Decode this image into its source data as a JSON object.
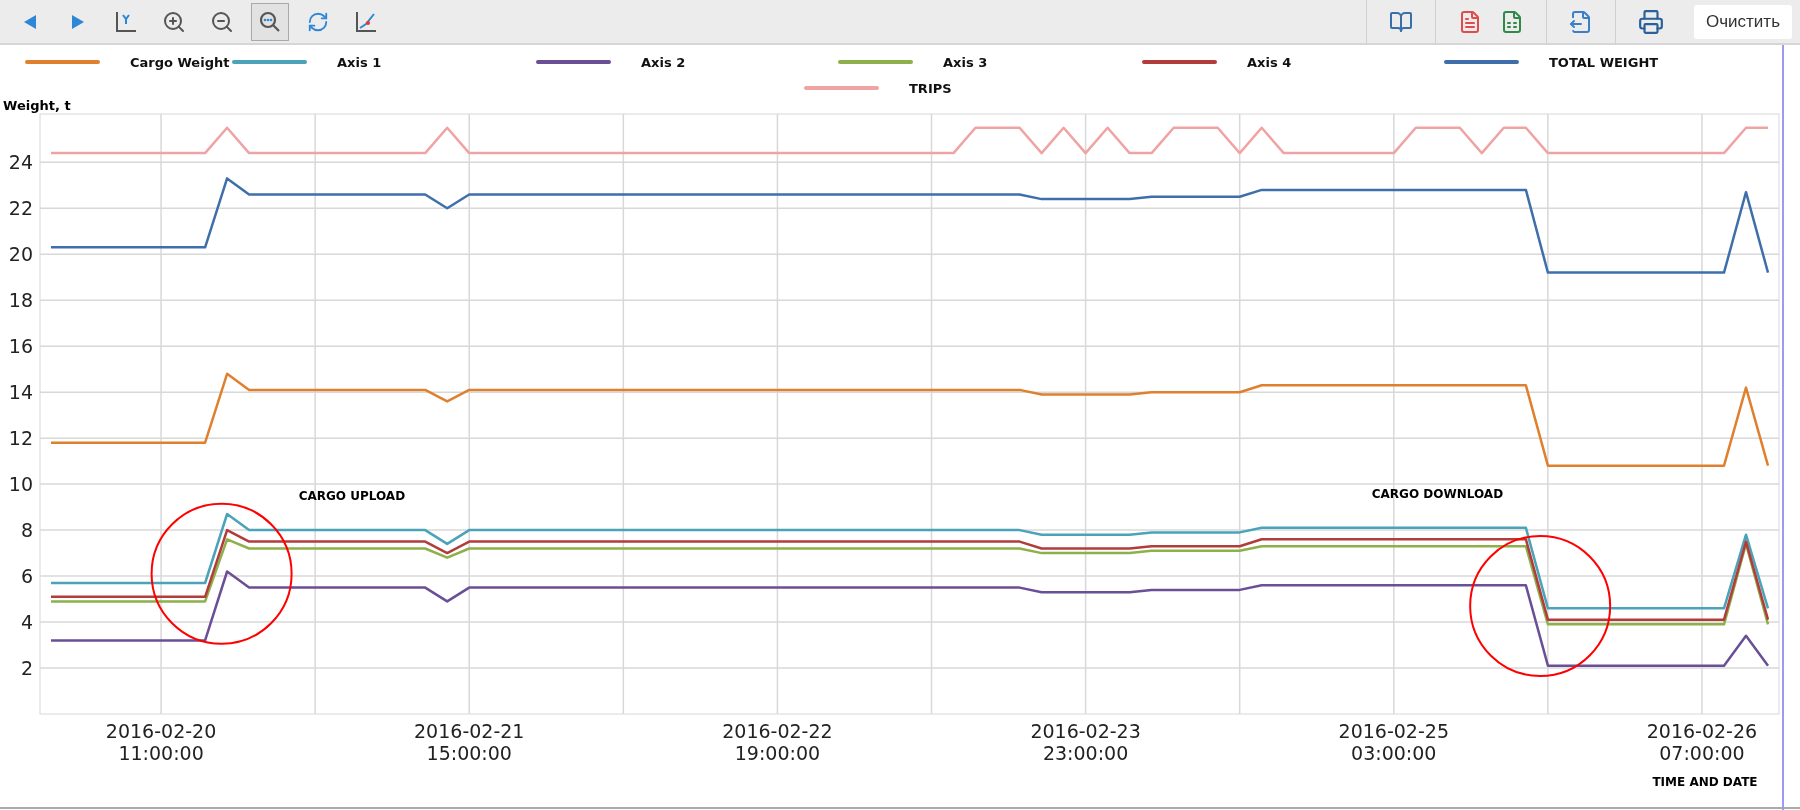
{
  "toolbar": {
    "tools": [
      {
        "kind": "prev",
        "selected": false
      },
      {
        "kind": "next",
        "selected": false
      },
      {
        "kind": "y-axis",
        "selected": false
      },
      {
        "kind": "zoom-in",
        "selected": false
      },
      {
        "kind": "zoom-out",
        "selected": false
      },
      {
        "kind": "zoom-fit",
        "selected": true
      },
      {
        "kind": "refresh",
        "selected": false
      },
      {
        "kind": "chart",
        "selected": false
      }
    ],
    "right_groups": [
      [
        {
          "kind": "book"
        }
      ],
      [
        {
          "kind": "pdf"
        },
        {
          "kind": "excel"
        }
      ],
      [
        {
          "kind": "export"
        }
      ],
      [
        {
          "kind": "print"
        }
      ]
    ],
    "clear_button": {
      "label": "Очистить"
    }
  },
  "chart_data": {
    "type": "line",
    "xlabel": "TIME AND DATE",
    "ylabel": "Weight, t",
    "categories": [
      null,
      null,
      null,
      null,
      null,
      "2016-02-20\n11:00:00",
      null,
      null,
      null,
      null,
      null,
      null,
      null,
      null,
      null,
      null,
      null,
      null,
      null,
      "2016-02-21\n15:00:00",
      null,
      null,
      null,
      null,
      null,
      null,
      null,
      null,
      null,
      null,
      null,
      null,
      null,
      "2016-02-22\n19:00:00",
      null,
      null,
      null,
      null,
      null,
      null,
      null,
      null,
      null,
      null,
      null,
      null,
      null,
      "2016-02-23\n23:00:00",
      null,
      null,
      null,
      null,
      null,
      null,
      null,
      null,
      null,
      null,
      null,
      null,
      null,
      "2016-02-25\n03:00:00",
      null,
      null,
      null,
      null,
      null,
      null,
      null,
      null,
      null,
      null,
      null,
      null,
      null,
      "2016-02-26\n07:00:00",
      null,
      null,
      null
    ],
    "series": [
      {
        "name": "Cargo Weight",
        "color": "#e0802e",
        "values": [
          11.8,
          11.8,
          11.8,
          11.8,
          11.8,
          11.8,
          11.8,
          11.8,
          14.8,
          14.1,
          14.1,
          14.1,
          14.1,
          14.1,
          14.1,
          14.1,
          14.1,
          14.1,
          13.6,
          14.1,
          14.1,
          14.1,
          14.1,
          14.1,
          14.1,
          14.1,
          14.1,
          14.1,
          14.1,
          14.1,
          14.1,
          14.1,
          14.1,
          14.1,
          14.1,
          14.1,
          14.1,
          14.1,
          14.1,
          14.1,
          14.1,
          14.1,
          14.1,
          14.1,
          14.1,
          13.9,
          13.9,
          13.9,
          13.9,
          13.9,
          14.0,
          14.0,
          14.0,
          14.0,
          14.0,
          14.3,
          14.3,
          14.3,
          14.3,
          14.3,
          14.3,
          14.3,
          14.3,
          14.3,
          14.3,
          14.3,
          14.3,
          14.3,
          10.8,
          10.8,
          10.8,
          10.8,
          10.8,
          10.8,
          10.8,
          10.8,
          10.8,
          14.2,
          10.8
        ]
      },
      {
        "name": "Axis 1",
        "color": "#4aa3b8",
        "values": [
          5.7,
          5.7,
          5.7,
          5.7,
          5.7,
          5.7,
          5.7,
          5.7,
          8.7,
          8.0,
          8.0,
          8.0,
          8.0,
          8.0,
          8.0,
          8.0,
          8.0,
          8.0,
          7.4,
          8.0,
          8.0,
          8.0,
          8.0,
          8.0,
          8.0,
          8.0,
          8.0,
          8.0,
          8.0,
          8.0,
          8.0,
          8.0,
          8.0,
          8.0,
          8.0,
          8.0,
          8.0,
          8.0,
          8.0,
          8.0,
          8.0,
          8.0,
          8.0,
          8.0,
          8.0,
          7.8,
          7.8,
          7.8,
          7.8,
          7.8,
          7.9,
          7.9,
          7.9,
          7.9,
          7.9,
          8.1,
          8.1,
          8.1,
          8.1,
          8.1,
          8.1,
          8.1,
          8.1,
          8.1,
          8.1,
          8.1,
          8.1,
          8.1,
          4.6,
          4.6,
          4.6,
          4.6,
          4.6,
          4.6,
          4.6,
          4.6,
          4.6,
          7.8,
          4.6
        ]
      },
      {
        "name": "Axis 2",
        "color": "#6b4f96",
        "values": [
          3.2,
          3.2,
          3.2,
          3.2,
          3.2,
          3.2,
          3.2,
          3.2,
          6.2,
          5.5,
          5.5,
          5.5,
          5.5,
          5.5,
          5.5,
          5.5,
          5.5,
          5.5,
          4.9,
          5.5,
          5.5,
          5.5,
          5.5,
          5.5,
          5.5,
          5.5,
          5.5,
          5.5,
          5.5,
          5.5,
          5.5,
          5.5,
          5.5,
          5.5,
          5.5,
          5.5,
          5.5,
          5.5,
          5.5,
          5.5,
          5.5,
          5.5,
          5.5,
          5.5,
          5.5,
          5.3,
          5.3,
          5.3,
          5.3,
          5.3,
          5.4,
          5.4,
          5.4,
          5.4,
          5.4,
          5.6,
          5.6,
          5.6,
          5.6,
          5.6,
          5.6,
          5.6,
          5.6,
          5.6,
          5.6,
          5.6,
          5.6,
          5.6,
          2.1,
          2.1,
          2.1,
          2.1,
          2.1,
          2.1,
          2.1,
          2.1,
          2.1,
          3.4,
          2.1
        ]
      },
      {
        "name": "Axis 3",
        "color": "#8db04a",
        "values": [
          4.9,
          4.9,
          4.9,
          4.9,
          4.9,
          4.9,
          4.9,
          4.9,
          7.6,
          7.2,
          7.2,
          7.2,
          7.2,
          7.2,
          7.2,
          7.2,
          7.2,
          7.2,
          6.8,
          7.2,
          7.2,
          7.2,
          7.2,
          7.2,
          7.2,
          7.2,
          7.2,
          7.2,
          7.2,
          7.2,
          7.2,
          7.2,
          7.2,
          7.2,
          7.2,
          7.2,
          7.2,
          7.2,
          7.2,
          7.2,
          7.2,
          7.2,
          7.2,
          7.2,
          7.2,
          7.0,
          7.0,
          7.0,
          7.0,
          7.0,
          7.1,
          7.1,
          7.1,
          7.1,
          7.1,
          7.3,
          7.3,
          7.3,
          7.3,
          7.3,
          7.3,
          7.3,
          7.3,
          7.3,
          7.3,
          7.3,
          7.3,
          7.3,
          3.9,
          3.9,
          3.9,
          3.9,
          3.9,
          3.9,
          3.9,
          3.9,
          3.9,
          7.4,
          3.9
        ]
      },
      {
        "name": "Axis 4",
        "color": "#b23c3c",
        "values": [
          5.1,
          5.1,
          5.1,
          5.1,
          5.1,
          5.1,
          5.1,
          5.1,
          8.0,
          7.5,
          7.5,
          7.5,
          7.5,
          7.5,
          7.5,
          7.5,
          7.5,
          7.5,
          7.0,
          7.5,
          7.5,
          7.5,
          7.5,
          7.5,
          7.5,
          7.5,
          7.5,
          7.5,
          7.5,
          7.5,
          7.5,
          7.5,
          7.5,
          7.5,
          7.5,
          7.5,
          7.5,
          7.5,
          7.5,
          7.5,
          7.5,
          7.5,
          7.5,
          7.5,
          7.5,
          7.2,
          7.2,
          7.2,
          7.2,
          7.2,
          7.3,
          7.3,
          7.3,
          7.3,
          7.3,
          7.6,
          7.6,
          7.6,
          7.6,
          7.6,
          7.6,
          7.6,
          7.6,
          7.6,
          7.6,
          7.6,
          7.6,
          7.6,
          4.1,
          4.1,
          4.1,
          4.1,
          4.1,
          4.1,
          4.1,
          4.1,
          4.1,
          7.5,
          4.1
        ]
      },
      {
        "name": "TOTAL WEIGHT",
        "color": "#3f6fab",
        "values": [
          20.3,
          20.3,
          20.3,
          20.3,
          20.3,
          20.3,
          20.3,
          20.3,
          23.3,
          22.6,
          22.6,
          22.6,
          22.6,
          22.6,
          22.6,
          22.6,
          22.6,
          22.6,
          22.0,
          22.6,
          22.6,
          22.6,
          22.6,
          22.6,
          22.6,
          22.6,
          22.6,
          22.6,
          22.6,
          22.6,
          22.6,
          22.6,
          22.6,
          22.6,
          22.6,
          22.6,
          22.6,
          22.6,
          22.6,
          22.6,
          22.6,
          22.6,
          22.6,
          22.6,
          22.6,
          22.4,
          22.4,
          22.4,
          22.4,
          22.4,
          22.5,
          22.5,
          22.5,
          22.5,
          22.5,
          22.8,
          22.8,
          22.8,
          22.8,
          22.8,
          22.8,
          22.8,
          22.8,
          22.8,
          22.8,
          22.8,
          22.8,
          22.8,
          19.2,
          19.2,
          19.2,
          19.2,
          19.2,
          19.2,
          19.2,
          19.2,
          19.2,
          22.7,
          19.2
        ]
      },
      {
        "name": "TRIPS",
        "color": "#f0a3a3",
        "values": [
          24.4,
          24.4,
          24.4,
          24.4,
          24.4,
          24.4,
          24.4,
          24.4,
          25.5,
          24.4,
          24.4,
          24.4,
          24.4,
          24.4,
          24.4,
          24.4,
          24.4,
          24.4,
          25.5,
          24.4,
          24.4,
          24.4,
          24.4,
          24.4,
          24.4,
          24.4,
          24.4,
          24.4,
          24.4,
          24.4,
          24.4,
          24.4,
          24.4,
          24.4,
          24.4,
          24.4,
          24.4,
          24.4,
          24.4,
          24.4,
          24.4,
          24.4,
          25.5,
          25.5,
          25.5,
          24.4,
          25.5,
          24.4,
          25.5,
          24.4,
          24.4,
          25.5,
          25.5,
          25.5,
          24.4,
          25.5,
          24.4,
          24.4,
          24.4,
          24.4,
          24.4,
          24.4,
          25.5,
          25.5,
          25.5,
          24.4,
          25.5,
          25.5,
          24.4,
          24.4,
          24.4,
          24.4,
          24.4,
          24.4,
          24.4,
          24.4,
          24.4,
          25.5,
          25.5
        ]
      }
    ],
    "ylim": [
      0,
      26.1
    ],
    "grid": true,
    "yticks": [
      2,
      4,
      6,
      8,
      10,
      12,
      14,
      16,
      18,
      20,
      22,
      24
    ],
    "annotations": [
      "CARGO UPLOAD",
      "CARGO DOWNLOAD"
    ]
  }
}
